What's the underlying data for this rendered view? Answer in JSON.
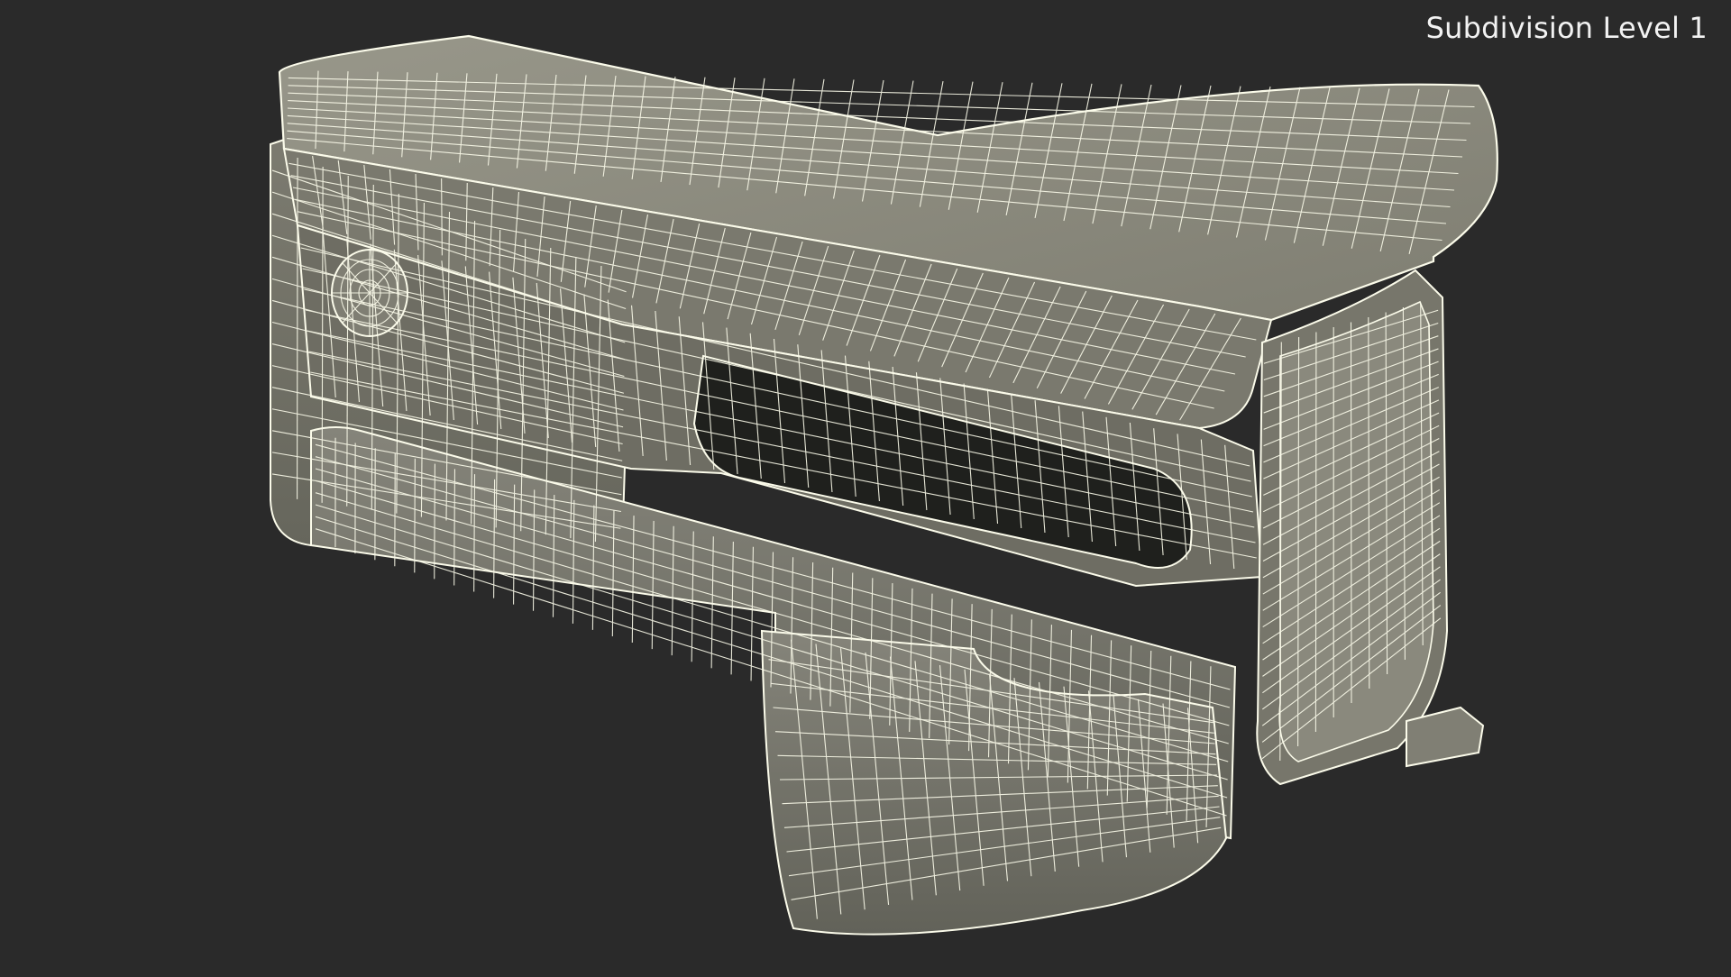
{
  "overlay": {
    "label": "Subdivision Level 1"
  },
  "scene": {
    "background_color": "#2a2a2a",
    "model_fill_light": "#8c8b7d",
    "model_fill_mid": "#76766a",
    "model_fill_dark": "#5b5b52",
    "cavity_color": "#1f201d",
    "wire_color": "#fbfbea",
    "object": "bench-vise-wireframe-model"
  }
}
